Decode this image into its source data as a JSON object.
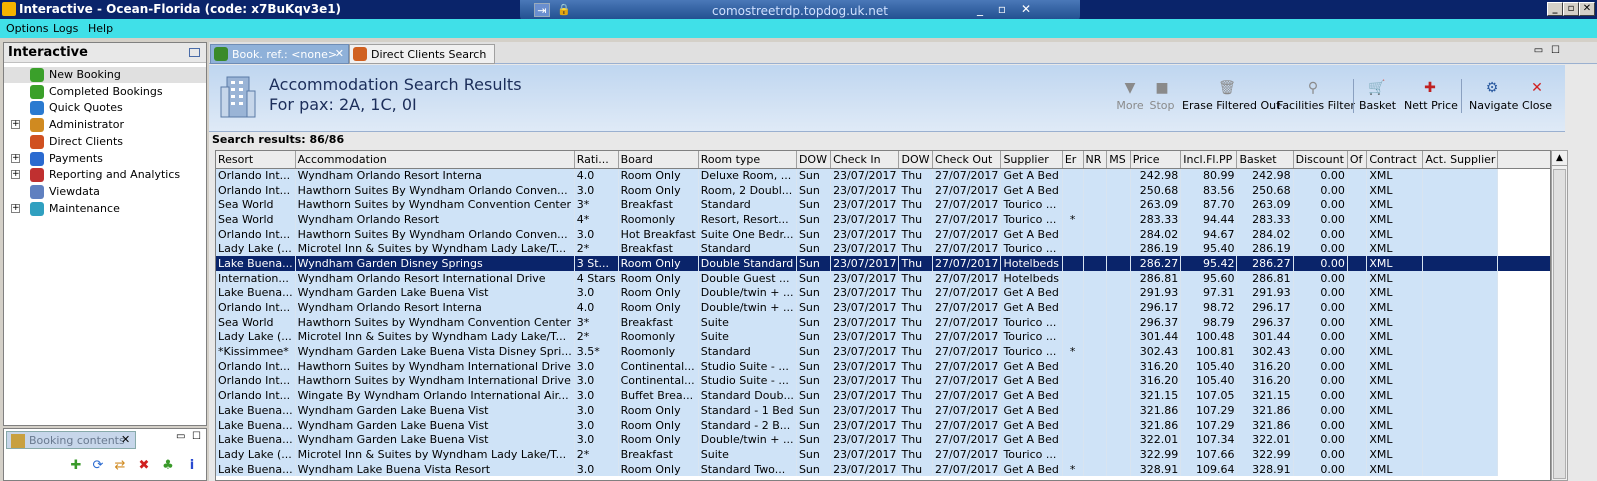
{
  "window": {
    "title": "Interactive - Ocean-Florida (code: x7BuKqv3e1)",
    "rdp_host": "comostreetrdp.topdog.uk.net",
    "controls": [
      "_",
      "▫",
      "✕"
    ]
  },
  "menu": [
    "Options",
    "Logs",
    "Help"
  ],
  "sidebar": {
    "title": "Interactive",
    "items": [
      {
        "label": "New Booking",
        "expandable": false,
        "icon": "palm-tree-icon",
        "color": "#3aa02a"
      },
      {
        "label": "Completed Bookings",
        "expandable": false,
        "icon": "palm-tree-icon",
        "color": "#3aa02a"
      },
      {
        "label": "Quick Quotes",
        "expandable": false,
        "icon": "clock-icon",
        "color": "#2a7ad0"
      },
      {
        "label": "Administrator",
        "expandable": true,
        "icon": "person-icon",
        "color": "#d08a20"
      },
      {
        "label": "Direct Clients",
        "expandable": false,
        "icon": "users-icon",
        "color": "#d05020"
      },
      {
        "label": "Payments",
        "expandable": true,
        "icon": "payments-icon",
        "color": "#2a6ad0"
      },
      {
        "label": "Reporting and Analytics",
        "expandable": true,
        "icon": "chart-icon",
        "color": "#c03030"
      },
      {
        "label": "Viewdata",
        "expandable": false,
        "icon": "document-icon",
        "color": "#6080c0"
      },
      {
        "label": "Maintenance",
        "expandable": true,
        "icon": "wrench-icon",
        "color": "#30a0c0"
      }
    ]
  },
  "booking_panel": {
    "tab_label": "Booking contents",
    "close": "✕"
  },
  "tabs": [
    {
      "label": "Book. ref.: <none>",
      "active": true,
      "close": "✕"
    },
    {
      "label": "Direct Clients Search",
      "active": false
    }
  ],
  "header": {
    "title": "Accommodation Search Results",
    "subtitle": "For pax: 2A, 1C, 0I"
  },
  "toolbar": [
    {
      "label": "More",
      "icon": "▼",
      "disabled": true
    },
    {
      "label": "Stop",
      "icon": "■",
      "disabled": true
    },
    {
      "label": "Erase Filtered Out",
      "icon": "🗑",
      "disabled": false
    },
    {
      "label": "Facilities Filter",
      "icon": "⚲",
      "disabled": false
    },
    {
      "label": "Basket",
      "icon": "🛒",
      "disabled": false
    },
    {
      "label": "Nett Price",
      "icon": "✚",
      "disabled": false
    },
    {
      "label": "Navigate",
      "icon": "⚙",
      "disabled": false
    },
    {
      "label": "Close",
      "icon": "✕",
      "disabled": false
    }
  ],
  "results_label": "Search results: 86/86",
  "columns": [
    "Resort",
    "Accommodation",
    "Rati...",
    "Board",
    "Room type",
    "DOW",
    "Check In",
    "DOW",
    "Check Out",
    "Supplier",
    "Er",
    "NR",
    "MS",
    "Price",
    "Incl.Fl.PP",
    "Basket",
    "Discount",
    "Of",
    "Contract",
    "Act. Supplier"
  ],
  "selected_row": 6,
  "rows": [
    [
      "Orlando Int...",
      "Wyndham Orlando Resort Interna",
      "4.0",
      "Room Only",
      "Deluxe Room, ...",
      "Sun",
      "23/07/2017",
      "Thu",
      "27/07/2017",
      "Get A Bed",
      "",
      "",
      "",
      "242.98",
      "80.99",
      "242.98",
      "0.00",
      "",
      "XML",
      ""
    ],
    [
      "Orlando Int...",
      "Hawthorn Suites By Wyndham Orlando Conven...",
      "3.0",
      "Room Only",
      "Room, 2 Doubl...",
      "Sun",
      "23/07/2017",
      "Thu",
      "27/07/2017",
      "Get A Bed",
      "",
      "",
      "",
      "250.68",
      "83.56",
      "250.68",
      "0.00",
      "",
      "XML",
      ""
    ],
    [
      "Sea World",
      "Hawthorn Suites by Wyndham Convention Center",
      "3*",
      "Breakfast",
      "Standard",
      "Sun",
      "23/07/2017",
      "Thu",
      "27/07/2017",
      "Tourico ...",
      "",
      "",
      "",
      "263.09",
      "87.70",
      "263.09",
      "0.00",
      "",
      "XML",
      ""
    ],
    [
      "Sea World",
      "Wyndham Orlando Resort",
      "4*",
      "Roomonly",
      "Resort, Resort...",
      "Sun",
      "23/07/2017",
      "Thu",
      "27/07/2017",
      "Tourico ...",
      "*",
      "",
      "",
      "283.33",
      "94.44",
      "283.33",
      "0.00",
      "",
      "XML",
      ""
    ],
    [
      "Orlando Int...",
      "Hawthorn Suites By Wyndham Orlando Conven...",
      "3.0",
      "Hot Breakfast",
      "Suite One Bedr...",
      "Sun",
      "23/07/2017",
      "Thu",
      "27/07/2017",
      "Get A Bed",
      "",
      "",
      "",
      "284.02",
      "94.67",
      "284.02",
      "0.00",
      "",
      "XML",
      ""
    ],
    [
      "Lady Lake (...",
      "Microtel Inn & Suites by Wyndham Lady Lake/T...",
      "2*",
      "Breakfast",
      "Standard",
      "Sun",
      "23/07/2017",
      "Thu",
      "27/07/2017",
      "Tourico ...",
      "",
      "",
      "",
      "286.19",
      "95.40",
      "286.19",
      "0.00",
      "",
      "XML",
      ""
    ],
    [
      "Lake Buena...",
      "Wyndham Garden Disney Springs",
      "3 St...",
      "Room Only",
      "Double Standard",
      "Sun",
      "23/07/2017",
      "Thu",
      "27/07/2017",
      "Hotelbeds",
      "",
      "",
      "",
      "286.27",
      "95.42",
      "286.27",
      "0.00",
      "",
      "XML",
      ""
    ],
    [
      "Internation...",
      "Wyndham Orlando Resort International Drive",
      "4 Stars",
      "Room Only",
      "Double Guest ...",
      "Sun",
      "23/07/2017",
      "Thu",
      "27/07/2017",
      "Hotelbeds",
      "",
      "",
      "",
      "286.81",
      "95.60",
      "286.81",
      "0.00",
      "",
      "XML",
      ""
    ],
    [
      "Lake Buena...",
      "Wyndham Garden Lake Buena Vist",
      "3.0",
      "Room Only",
      "Double/twin + ...",
      "Sun",
      "23/07/2017",
      "Thu",
      "27/07/2017",
      "Get A Bed",
      "",
      "",
      "",
      "291.93",
      "97.31",
      "291.93",
      "0.00",
      "",
      "XML",
      ""
    ],
    [
      "Orlando Int...",
      "Wyndham Orlando Resort Interna",
      "4.0",
      "Room Only",
      "Double/twin + ...",
      "Sun",
      "23/07/2017",
      "Thu",
      "27/07/2017",
      "Get A Bed",
      "",
      "",
      "",
      "296.17",
      "98.72",
      "296.17",
      "0.00",
      "",
      "XML",
      ""
    ],
    [
      "Sea World",
      "Hawthorn Suites by Wyndham Convention Center",
      "3*",
      "Breakfast",
      "Suite",
      "Sun",
      "23/07/2017",
      "Thu",
      "27/07/2017",
      "Tourico ...",
      "",
      "",
      "",
      "296.37",
      "98.79",
      "296.37",
      "0.00",
      "",
      "XML",
      ""
    ],
    [
      "Lady Lake (...",
      "Microtel Inn & Suites by Wyndham Lady Lake/T...",
      "2*",
      "Roomonly",
      "Suite",
      "Sun",
      "23/07/2017",
      "Thu",
      "27/07/2017",
      "Tourico ...",
      "",
      "",
      "",
      "301.44",
      "100.48",
      "301.44",
      "0.00",
      "",
      "XML",
      ""
    ],
    [
      "*Kissimmee*",
      "Wyndham Garden Lake Buena Vista Disney Spri...",
      "3.5*",
      "Roomonly",
      "Standard",
      "Sun",
      "23/07/2017",
      "Thu",
      "27/07/2017",
      "Tourico ...",
      "*",
      "",
      "",
      "302.43",
      "100.81",
      "302.43",
      "0.00",
      "",
      "XML",
      ""
    ],
    [
      "Orlando Int...",
      "Hawthorn Suites by Wyndham International Drive",
      "3.0",
      "Continental...",
      "Studio Suite - ...",
      "Sun",
      "23/07/2017",
      "Thu",
      "27/07/2017",
      "Get A Bed",
      "",
      "",
      "",
      "316.20",
      "105.40",
      "316.20",
      "0.00",
      "",
      "XML",
      ""
    ],
    [
      "Orlando Int...",
      "Hawthorn Suites by Wyndham International Drive",
      "3.0",
      "Continental...",
      "Studio Suite - ...",
      "Sun",
      "23/07/2017",
      "Thu",
      "27/07/2017",
      "Get A Bed",
      "",
      "",
      "",
      "316.20",
      "105.40",
      "316.20",
      "0.00",
      "",
      "XML",
      ""
    ],
    [
      "Orlando Int...",
      "Wingate By Wyndham Orlando International Air...",
      "3.0",
      "Buffet Brea...",
      "Standard Doub...",
      "Sun",
      "23/07/2017",
      "Thu",
      "27/07/2017",
      "Get A Bed",
      "",
      "",
      "",
      "321.15",
      "107.05",
      "321.15",
      "0.00",
      "",
      "XML",
      ""
    ],
    [
      "Lake Buena...",
      "Wyndham Garden Lake Buena Vist",
      "3.0",
      "Room Only",
      "Standard - 1 Bed",
      "Sun",
      "23/07/2017",
      "Thu",
      "27/07/2017",
      "Get A Bed",
      "",
      "",
      "",
      "321.86",
      "107.29",
      "321.86",
      "0.00",
      "",
      "XML",
      ""
    ],
    [
      "Lake Buena...",
      "Wyndham Garden Lake Buena Vist",
      "3.0",
      "Room Only",
      "Standard - 2 B...",
      "Sun",
      "23/07/2017",
      "Thu",
      "27/07/2017",
      "Get A Bed",
      "",
      "",
      "",
      "321.86",
      "107.29",
      "321.86",
      "0.00",
      "",
      "XML",
      ""
    ],
    [
      "Lake Buena...",
      "Wyndham Garden Lake Buena Vist",
      "3.0",
      "Room Only",
      "Double/twin + ...",
      "Sun",
      "23/07/2017",
      "Thu",
      "27/07/2017",
      "Get A Bed",
      "",
      "",
      "",
      "322.01",
      "107.34",
      "322.01",
      "0.00",
      "",
      "XML",
      ""
    ],
    [
      "Lady Lake (...",
      "Microtel Inn & Suites by Wyndham Lady Lake/T...",
      "2*",
      "Breakfast",
      "Suite",
      "Sun",
      "23/07/2017",
      "Thu",
      "27/07/2017",
      "Tourico ...",
      "",
      "",
      "",
      "322.99",
      "107.66",
      "322.99",
      "0.00",
      "",
      "XML",
      ""
    ],
    [
      "Lake Buena...",
      "Wyndham Lake Buena Vista Resort",
      "3.0",
      "Room Only",
      "Standard Two...",
      "Sun",
      "23/07/2017",
      "Thu",
      "27/07/2017",
      "Get A Bed",
      "*",
      "",
      "",
      "328.91",
      "109.64",
      "328.91",
      "0.00",
      "",
      "XML",
      ""
    ]
  ]
}
